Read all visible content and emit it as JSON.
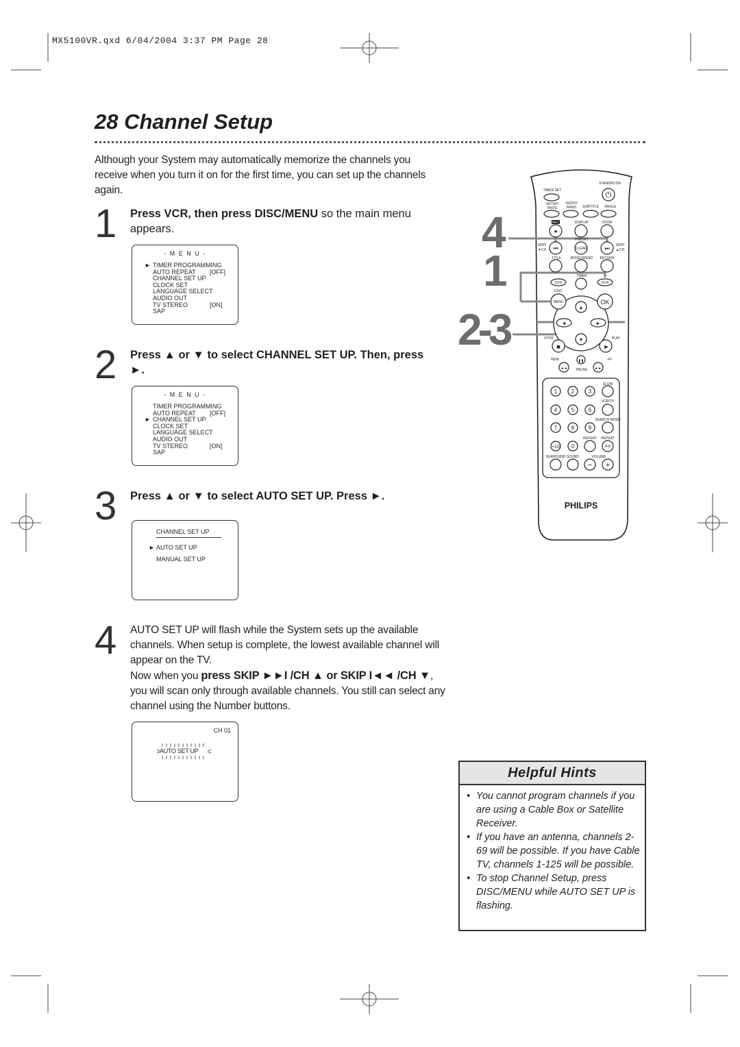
{
  "header": "MX5100VR.qxd   6/04/2004   3:37 PM   Page 28",
  "title": "28  Channel Setup",
  "intro": "Although your System may automatically memorize the channels you receive when you turn it on for the first time, you can set up the channels again.",
  "steps": [
    {
      "num": "1",
      "bold": "Press VCR, then press DISC/MENU",
      "rest": " so the main menu appears."
    },
    {
      "num": "2",
      "bold": "Press ▲ or ▼ to select CHANNEL SET UP. Then, press ►."
    },
    {
      "num": "3",
      "bold": "Press ▲ or ▼ to select AUTO SET UP.  Press ►."
    },
    {
      "num": "4",
      "text1": "AUTO SET UP will flash while the System sets up the available channels. When setup is complete, the lowest available channel will appear on the TV.",
      "text2a": "Now when you ",
      "text2b": "press SKIP ►►I /CH ▲ or SKIP I◄◄ /CH ▼",
      "text2c": ", you will scan only through available channels. You still can select any channel using the Number buttons."
    }
  ],
  "menu": {
    "title": "- M E N U -",
    "items": [
      {
        "label": "TIMER PROGRAMMING",
        "value": ""
      },
      {
        "label": "AUTO REPEAT",
        "value": "[OFF]"
      },
      {
        "label": "CHANNEL SET UP",
        "value": ""
      },
      {
        "label": "CLOCK SET",
        "value": ""
      },
      {
        "label": "LANGUAGE SELECT",
        "value": ""
      },
      {
        "label": "AUDIO OUT",
        "value": ""
      },
      {
        "label": "TV STEREO",
        "value": "[ON]"
      },
      {
        "label": "SAP",
        "value": ""
      }
    ],
    "cursor": "►"
  },
  "channel_menu": {
    "title": "CHANNEL SET UP",
    "items": [
      "AUTO SET UP",
      "MANUAL SET UP"
    ]
  },
  "tv_screen": {
    "channel": "CH 01",
    "flashing": "AUTO SET UP"
  },
  "callouts": [
    "4",
    "1",
    "2-3"
  ],
  "remote": {
    "brand": "PHILIPS",
    "labels": [
      "STANDBY-ON",
      "TIMER SET",
      "SETUP/",
      "PROG",
      "AUDIO/",
      "BAND",
      "SUBTITLE",
      "ANGLE",
      "REC",
      "DISPLAY",
      "ZOOM",
      "PRESET",
      "SKIP/",
      "▼CH",
      "SKIP/",
      "▲CH",
      "CLEAR",
      "TITLE",
      "MODE/SPEED",
      "RETURN",
      "TIMER",
      "DVD",
      "VCR",
      "DISC",
      "MENU",
      "OK",
      "STOP",
      "PLAY",
      "REW",
      "FF",
      "PAUSE",
      "SLOW",
      "VCR/TV",
      "SEARCH MODE",
      "REPEAT",
      "REPEAT",
      "A-B",
      "SURROUND",
      "SOUND",
      "VOLUME",
      "1",
      "2",
      "3",
      "4",
      "5",
      "6",
      "7",
      "8",
      "9",
      "+10",
      "0"
    ]
  },
  "hints": {
    "title": "Helpful Hints",
    "items": [
      "You cannot program channels if you are using a Cable Box or Satellite Receiver.",
      "If you have an antenna, channels 2-69 will be possible. If you have Cable TV, channels 1-125 will be possible.",
      "To stop Channel Setup, press DISC/MENU while AUTO SET UP is flashing."
    ]
  }
}
